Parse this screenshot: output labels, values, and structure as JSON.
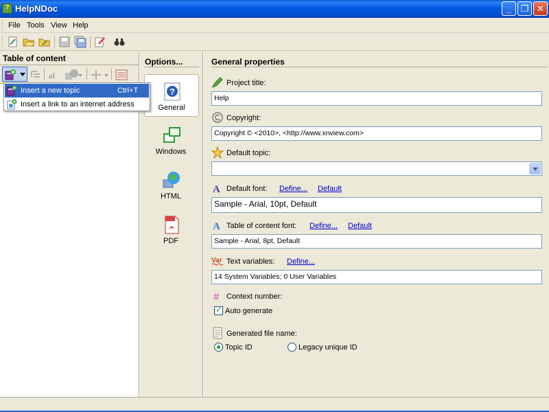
{
  "window": {
    "title": "HelpNDoc",
    "min_icon": "minimize-icon",
    "max_icon": "maximize-icon",
    "close_icon": "close-icon"
  },
  "menu": [
    "File",
    "Tools",
    "View",
    "Help"
  ],
  "toolbar": {
    "icons": [
      "new-project-icon",
      "open-project-icon",
      "open-folder-icon",
      "save-icon",
      "save-all-icon",
      "edit-icon",
      "find-icon"
    ]
  },
  "toc": {
    "header": "Table of content",
    "toolbar_icons": [
      "add-topic-icon",
      "dropdown-arrow-icon",
      "outline-icon",
      "rename-icon",
      "shape-icon",
      "move-icon",
      "list-icon"
    ]
  },
  "dropdown": {
    "items": [
      {
        "label": "Insert a new topic",
        "shortcut": "Ctrl+T",
        "icon": "book-icon",
        "selected": true
      },
      {
        "label": "Insert a link to an internet address",
        "shortcut": "",
        "icon": "web-link-icon",
        "selected": false
      }
    ]
  },
  "options": {
    "header": "Options...",
    "items": [
      {
        "label": "General",
        "icon": "help-question-icon",
        "active": true
      },
      {
        "label": "Windows",
        "icon": "windows-icon",
        "active": false
      },
      {
        "label": "HTML",
        "icon": "globe-icon",
        "active": false
      },
      {
        "label": "PDF",
        "icon": "pdf-icon",
        "active": false
      }
    ]
  },
  "props": {
    "header": "General properties",
    "project_title_label": "Project title:",
    "project_title_value": "Help",
    "copyright_label": "Copyright:",
    "copyright_value": "Copyright © <2010>, <http://www.xnview.com>",
    "default_topic_label": "Default topic:",
    "default_topic_value": "",
    "default_font_label": "Default font:",
    "default_font_define": "Define...",
    "default_font_default": "Default",
    "default_font_value": "Sample - Arial, 10pt, Default",
    "toc_font_label": "Table of content font:",
    "toc_font_define": "Define...",
    "toc_font_default": "Default",
    "toc_font_value": "Sample - Arial, 8pt, Default",
    "text_vars_label": "Text variables:",
    "text_vars_define": "Define...",
    "text_vars_value": "14 System Variables; 0 User Variables",
    "context_number_label": "Context number:",
    "auto_generate_label": "Auto generate",
    "auto_generate_checked": true,
    "gen_file_label": "Generated file name:",
    "radio_topic_id": "Topic ID",
    "radio_legacy": "Legacy unique ID",
    "selected_radio": "Topic ID"
  },
  "colors": {
    "titlebar": "#0058e6",
    "selection": "#316ac5",
    "link": "#0000cc",
    "checkmark": "#21a121"
  }
}
